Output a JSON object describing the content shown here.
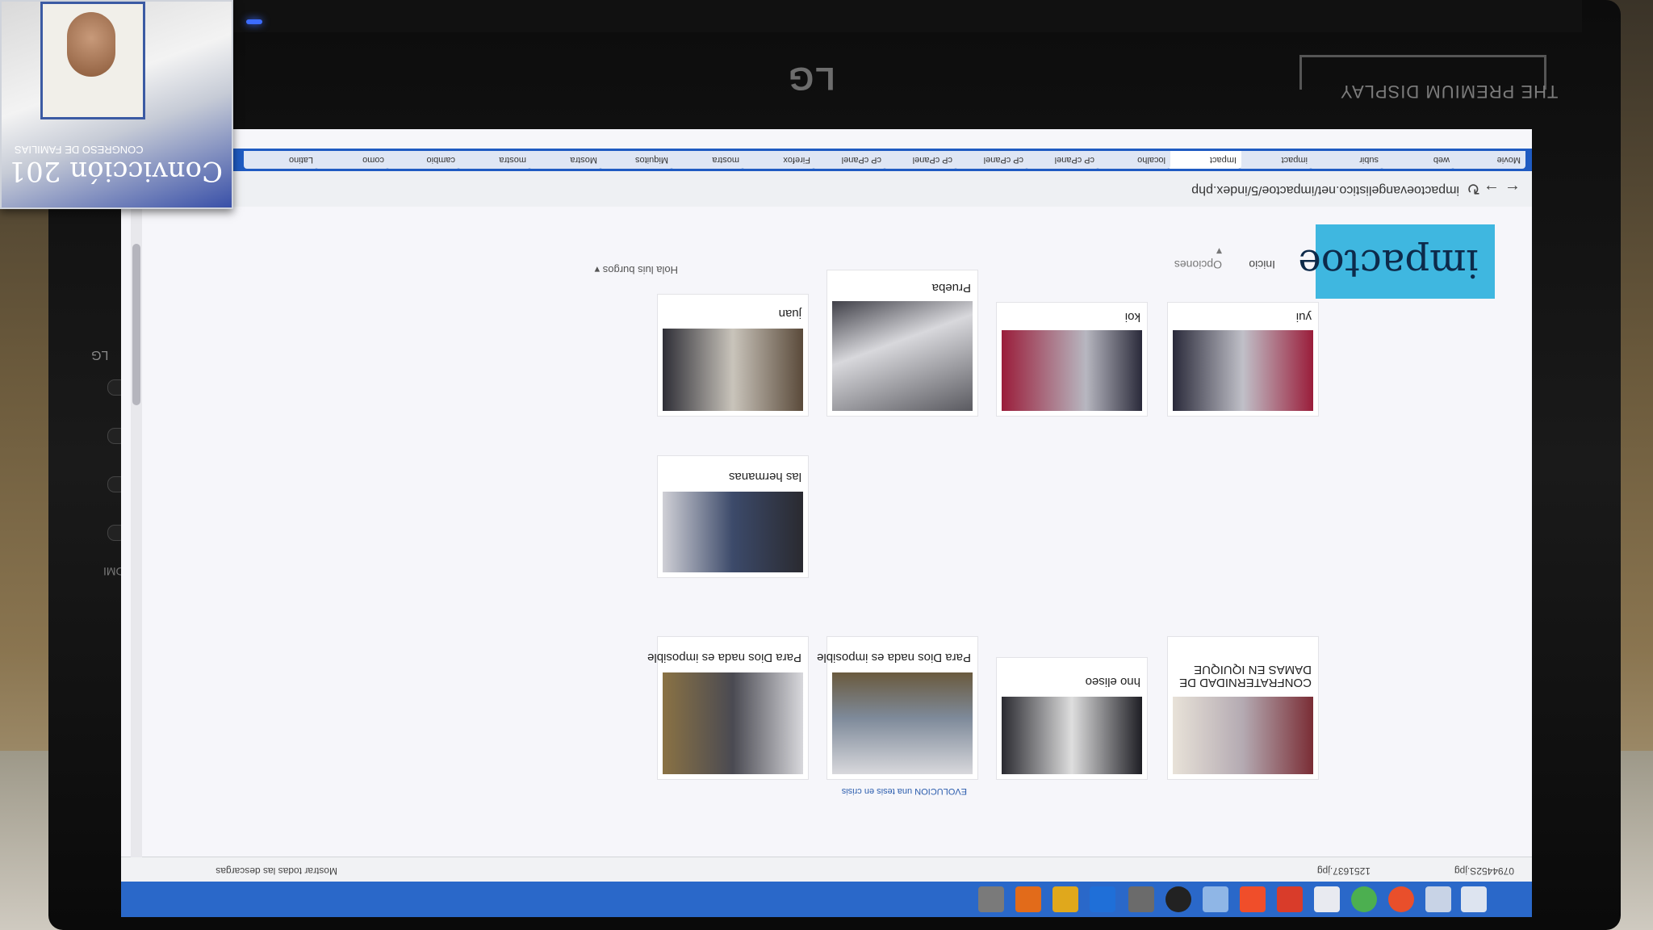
{
  "scene": {
    "monitor_brand": "LG",
    "monitor_tagline": "THE PREMIUM DISPLAY",
    "bezel_label_small": "LG",
    "bezel_label_hdmi": "HDMI",
    "badge_title": "Convicción 201",
    "badge_subtitle": "CONGRESO DE FAMILIAS"
  },
  "browser": {
    "url": "impactoevangelistico.net/impactoe/5/index.php",
    "tabs": [
      "Movie",
      "web",
      "subir",
      "impact",
      "Impact",
      "localho",
      "cP cPanel",
      "cP cPanel",
      "cP cPanel",
      "cP cPanel",
      "Firefox",
      "mostra",
      "Miquitos",
      "Mostra",
      "mostra",
      "cambio",
      "como",
      "Latino"
    ],
    "bookmarks_left": "0794452S.jpg",
    "bookmarks_mid": "1251637.jpg",
    "bookmarks_right": "Mostrar todas las descargas"
  },
  "site": {
    "logo": "impactoe",
    "nav": {
      "inicio": "Inicio",
      "opciones": "Opciones ▾"
    },
    "user_greeting": "Hola luis burgos ▾",
    "gallery": [
      {
        "caption": "yui"
      },
      {
        "caption": "koi"
      },
      {
        "caption": "Prueba"
      },
      {
        "caption": "juan"
      },
      {
        "caption": "las hermanas"
      },
      {
        "caption": "CONFRATERNIDAD DE DAMAS EN IQUIQUE"
      },
      {
        "caption": "hno eliseo"
      },
      {
        "caption": "Para Dios nada es imposible"
      },
      {
        "caption": "Para Dios nada es imposible"
      }
    ],
    "bottom_note": "EVOLUCION una tesis en crisis"
  },
  "colors": {
    "taskbar": "#2a68c9",
    "logo_bg": "#3fb7e0",
    "logo_text": "#0d2a4a"
  }
}
